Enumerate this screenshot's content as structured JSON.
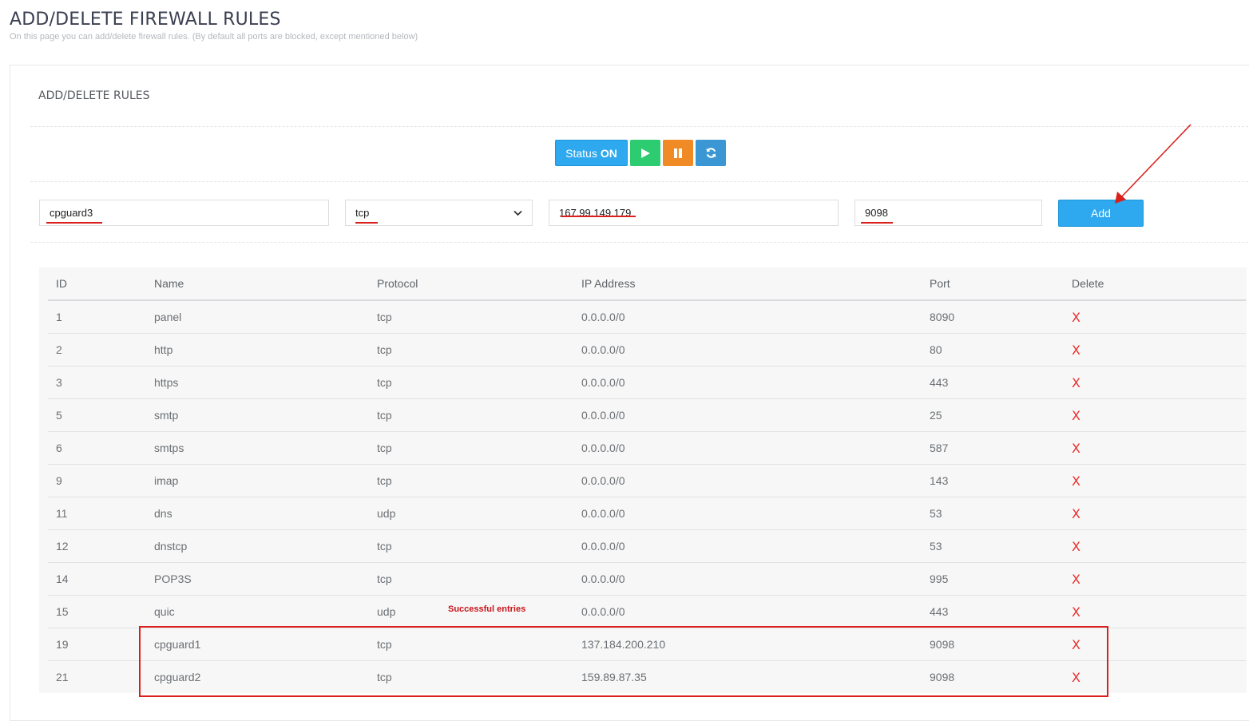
{
  "page": {
    "title": "ADD/DELETE FIREWALL RULES",
    "subtitle": "On this page you can add/delete firewall rules. (By default all ports are blocked, except mentioned below)"
  },
  "panel": {
    "title": "ADD/DELETE RULES"
  },
  "controls": {
    "status_label": "Status",
    "status_value": "ON",
    "play_icon": "play-icon",
    "pause_icon": "pause-icon",
    "refresh_icon": "refresh-icon"
  },
  "form": {
    "name_value": "cpguard3",
    "protocol_value": "tcp",
    "ip_value": "167.99.149.179",
    "port_value": "9098",
    "add_label": "Add"
  },
  "table": {
    "headers": {
      "id": "ID",
      "name": "Name",
      "protocol": "Protocol",
      "ip": "IP Address",
      "port": "Port",
      "delete": "Delete"
    },
    "delete_symbol": "X",
    "rows": [
      {
        "id": "1",
        "name": "panel",
        "protocol": "tcp",
        "ip": "0.0.0.0/0",
        "port": "8090"
      },
      {
        "id": "2",
        "name": "http",
        "protocol": "tcp",
        "ip": "0.0.0.0/0",
        "port": "80"
      },
      {
        "id": "3",
        "name": "https",
        "protocol": "tcp",
        "ip": "0.0.0.0/0",
        "port": "443"
      },
      {
        "id": "5",
        "name": "smtp",
        "protocol": "tcp",
        "ip": "0.0.0.0/0",
        "port": "25"
      },
      {
        "id": "6",
        "name": "smtps",
        "protocol": "tcp",
        "ip": "0.0.0.0/0",
        "port": "587"
      },
      {
        "id": "9",
        "name": "imap",
        "protocol": "tcp",
        "ip": "0.0.0.0/0",
        "port": "143"
      },
      {
        "id": "11",
        "name": "dns",
        "protocol": "udp",
        "ip": "0.0.0.0/0",
        "port": "53"
      },
      {
        "id": "12",
        "name": "dnstcp",
        "protocol": "tcp",
        "ip": "0.0.0.0/0",
        "port": "53"
      },
      {
        "id": "14",
        "name": "POP3S",
        "protocol": "tcp",
        "ip": "0.0.0.0/0",
        "port": "995"
      },
      {
        "id": "15",
        "name": "quic",
        "protocol": "udp",
        "ip": "0.0.0.0/0",
        "port": "443"
      },
      {
        "id": "19",
        "name": "cpguard1",
        "protocol": "tcp",
        "ip": "137.184.200.210",
        "port": "9098"
      },
      {
        "id": "21",
        "name": "cpguard2",
        "protocol": "tcp",
        "ip": "159.89.87.35",
        "port": "9098"
      }
    ]
  },
  "annotation": {
    "label": "Successful entries",
    "color": "#d9201c"
  },
  "colors": {
    "primary_blue": "#2ea8ee",
    "play_green": "#2ecc71",
    "pause_orange": "#f08a24",
    "refresh_blue": "#3a97d4",
    "delete_red": "#e8312f"
  }
}
